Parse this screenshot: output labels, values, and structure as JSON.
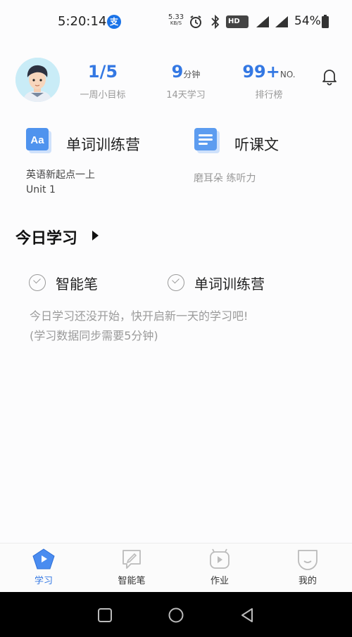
{
  "status_bar": {
    "time": "5:20:14",
    "app_icon_glyph": "支",
    "net_speed": "5.33",
    "net_speed_unit": "KB/S",
    "hd": "HD",
    "battery": "54%"
  },
  "stats": [
    {
      "value": "1/5",
      "unit": "",
      "caption": "一周小目标"
    },
    {
      "value": "9",
      "unit": "分钟",
      "caption": "14天学习"
    },
    {
      "value": "99+",
      "unit": "NO.",
      "caption": "排行榜"
    }
  ],
  "cards": {
    "vocab": {
      "title": "单词训练营",
      "line1": "英语新起点一上",
      "line2": "Unit 1",
      "icon_text": "Aa"
    },
    "listen": {
      "title": "听课文",
      "subtitle": "磨耳朵 练听力"
    }
  },
  "today": {
    "title": "今日学习",
    "items": [
      {
        "label": "智能笔"
      },
      {
        "label": "单词训练营"
      }
    ],
    "hint_line1": "今日学习还没开始，快开启新一天的学习吧!",
    "hint_line2": "(学习数据同步需要5分钟)"
  },
  "bottom_nav": [
    {
      "label": "学习",
      "icon": "play-icon",
      "active": true
    },
    {
      "label": "智能笔",
      "icon": "pen-icon",
      "active": false
    },
    {
      "label": "作业",
      "icon": "homework-icon",
      "active": false
    },
    {
      "label": "我的",
      "icon": "profile-icon",
      "active": false
    }
  ],
  "colors": {
    "accent": "#3478e3",
    "muted": "#999999"
  }
}
